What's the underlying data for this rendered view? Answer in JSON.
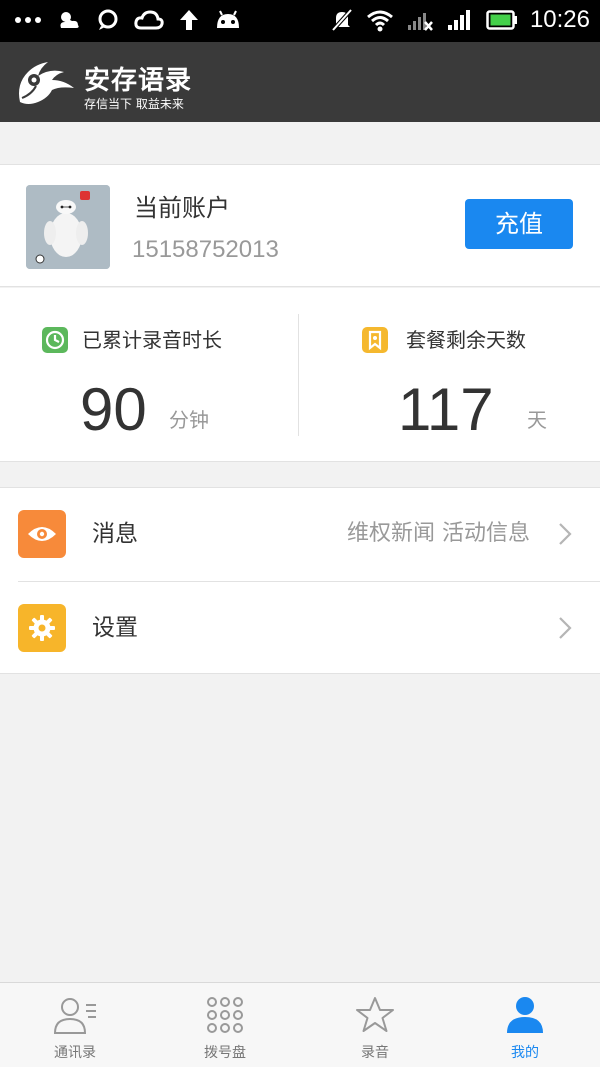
{
  "status_bar": {
    "time": "10:26",
    "icons": [
      "more-dots-icon",
      "weather-icon",
      "chat-icon",
      "cloud-icon",
      "upload-arrow-icon",
      "android-icon",
      "mute-icon",
      "wifi-icon",
      "signal-x-icon",
      "signal-icon",
      "battery-icon"
    ],
    "battery_color": "#44d04a"
  },
  "header": {
    "app_name": "安存语录",
    "slogan": "存信当下 取益未来",
    "background": "#3a3a3a"
  },
  "account": {
    "title": "当前账户",
    "phone": "15158752013",
    "recharge_label": "充值",
    "accent": "#1a88f0"
  },
  "stats": [
    {
      "icon": "clock-icon",
      "icon_color": "#5cb85c",
      "label": "已累计录音时长",
      "value": "90",
      "unit": "分钟"
    },
    {
      "icon": "bookmark-icon",
      "icon_color": "#f5b82e",
      "label": "套餐剩余天数",
      "value": "117",
      "unit": "天"
    }
  ],
  "menu": [
    {
      "icon": "eye-icon",
      "icon_color": "#f78a3a",
      "label": "消息",
      "detail": "维权新闻 活动信息"
    },
    {
      "icon": "gear-icon",
      "icon_color": "#f7b52a",
      "label": "设置",
      "detail": ""
    }
  ],
  "bottom_nav": [
    {
      "icon": "contacts-icon",
      "label": "通讯录",
      "active": false
    },
    {
      "icon": "dialpad-icon",
      "label": "拨号盘",
      "active": false
    },
    {
      "icon": "star-icon",
      "label": "录音",
      "active": false
    },
    {
      "icon": "person-icon",
      "label": "我的",
      "active": true
    }
  ]
}
